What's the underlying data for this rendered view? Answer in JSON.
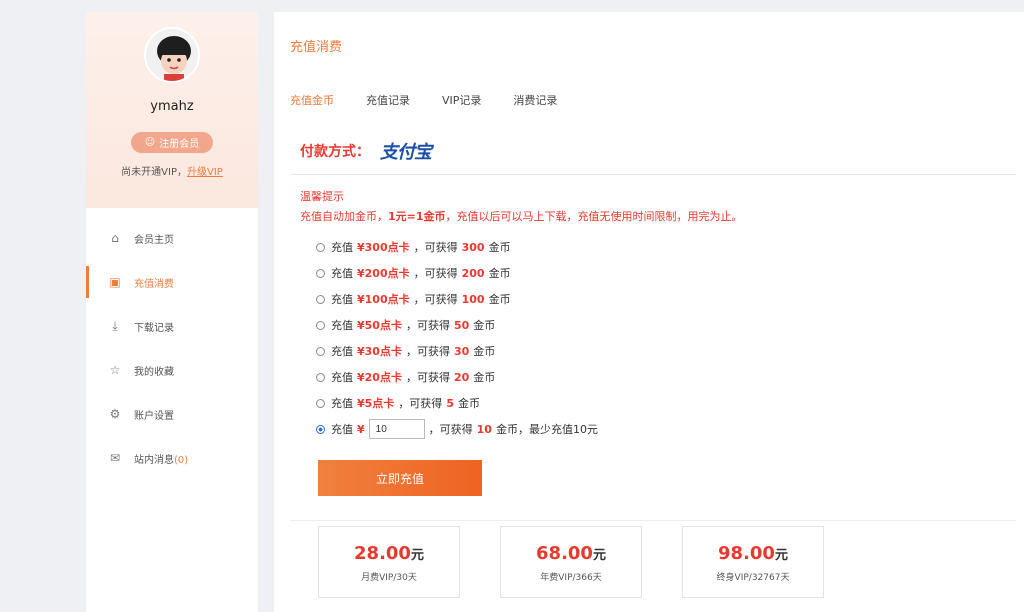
{
  "profile": {
    "username": "ymahz",
    "register_badge": "注册会员",
    "vip_text": "尚未开通VIP，",
    "vip_link": "升级VIP"
  },
  "menu": {
    "items": [
      {
        "label": "会员主页",
        "icon": "home-icon"
      },
      {
        "label": "充值消费",
        "icon": "recharge-icon",
        "active": true
      },
      {
        "label": "下载记录",
        "icon": "download-icon"
      },
      {
        "label": "我的收藏",
        "icon": "star-icon"
      },
      {
        "label": "账户设置",
        "icon": "gear-icon"
      },
      {
        "label": "站内消息",
        "icon": "mail-icon",
        "count": "(0)"
      }
    ]
  },
  "main": {
    "title": "充值消费",
    "tabs": [
      "充值金币",
      "充值记录",
      "VIP记录",
      "消费记录"
    ],
    "payment_label": "付款方式：",
    "payment_method": "支付宝",
    "tip_title": "温馨提示",
    "tip_text_1": "充值自动加金币，",
    "tip_text_2": "1元=1金币",
    "tip_text_3": "，充值以后可以马上下载，充值无使用时间限制，用完为止。",
    "options": [
      {
        "card": "¥300点卡",
        "coins": "300"
      },
      {
        "card": "¥200点卡",
        "coins": "200"
      },
      {
        "card": "¥100点卡",
        "coins": "100"
      },
      {
        "card": "¥50点卡",
        "coins": "50"
      },
      {
        "card": "¥30点卡",
        "coins": "30"
      },
      {
        "card": "¥20点卡",
        "coins": "20"
      },
      {
        "card": "¥5点卡",
        "coins": "5"
      }
    ],
    "option_prefix": "充值",
    "option_mid": "，可获得",
    "option_suffix": "金币",
    "custom": {
      "prefix": "充值",
      "currency": "¥",
      "value": "10",
      "mid": "，可获得",
      "coins": "10",
      "suffix": "金币，最少充值10元"
    },
    "submit_label": "立即充值",
    "vip_plans": [
      {
        "price": "28.00",
        "unit": "元",
        "desc": "月费VIP/30天"
      },
      {
        "price": "68.00",
        "unit": "元",
        "desc": "年费VIP/366天"
      },
      {
        "price": "98.00",
        "unit": "元",
        "desc": "终身VIP/32767天"
      }
    ]
  },
  "colors": {
    "accent": "#f27a3b",
    "warning": "#e8392f",
    "alipay_blue": "#1b4fa8"
  }
}
